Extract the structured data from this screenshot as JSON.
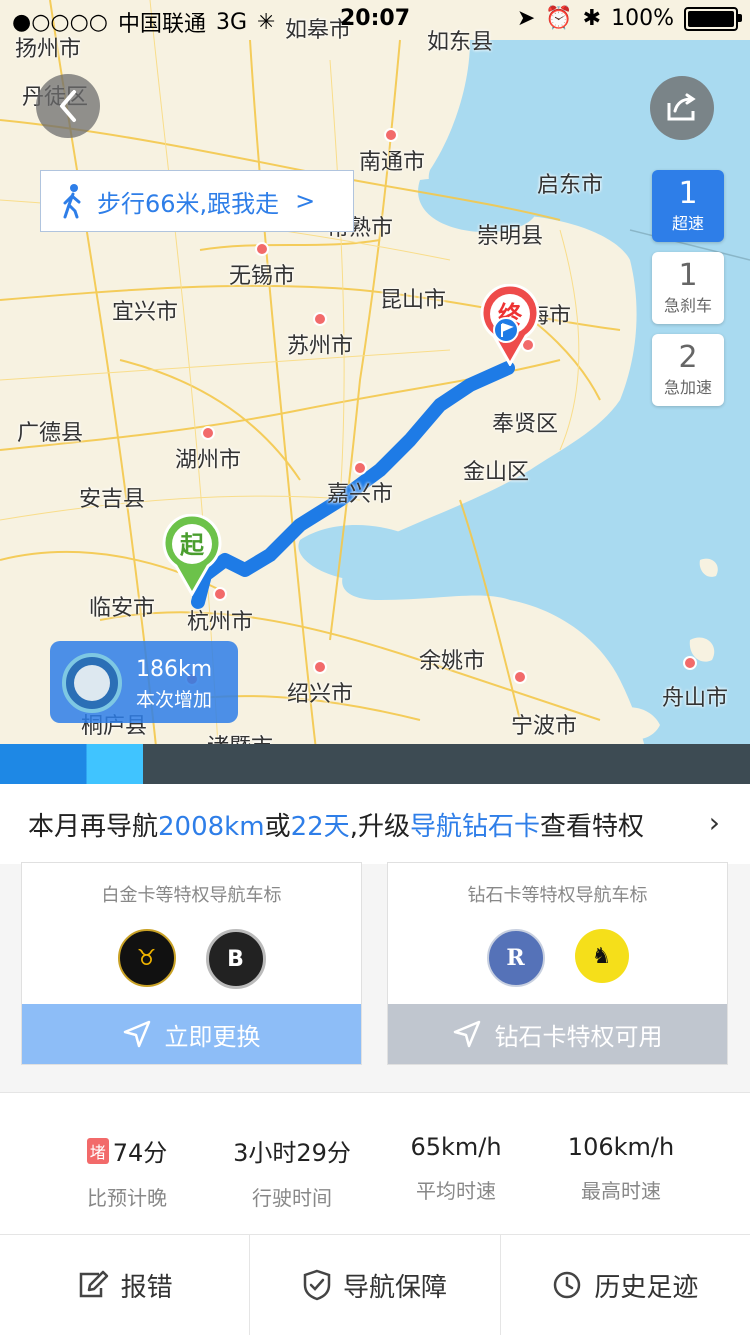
{
  "status_bar": {
    "signal": "●○○○○",
    "carrier": "中国联通",
    "network": "3G",
    "time": "20:07",
    "battery": "100%"
  },
  "map": {
    "cities": [
      {
        "name": "扬州市"
      },
      {
        "name": "如皋市"
      },
      {
        "name": "如东县"
      },
      {
        "name": "丹徒区"
      },
      {
        "name": "南通市"
      },
      {
        "name": "启东市"
      },
      {
        "name": "常熟市"
      },
      {
        "name": "崇明县"
      },
      {
        "name": "无锡市"
      },
      {
        "name": "宜兴市"
      },
      {
        "name": "昆山市"
      },
      {
        "name": "苏州市"
      },
      {
        "name": "上海市"
      },
      {
        "name": "广德县"
      },
      {
        "name": "奉贤区"
      },
      {
        "name": "湖州市"
      },
      {
        "name": "嘉兴市"
      },
      {
        "name": "金山区"
      },
      {
        "name": "安吉县"
      },
      {
        "name": "临安市"
      },
      {
        "name": "杭州市"
      },
      {
        "name": "余姚市"
      },
      {
        "name": "绍兴市"
      },
      {
        "name": "舟山市"
      },
      {
        "name": "桐庐县"
      },
      {
        "name": "宁波市"
      },
      {
        "name": "诸暨市"
      }
    ],
    "start_label": "起",
    "end_label": "终"
  },
  "walk_tip": {
    "text": "步行66米,跟我走",
    "arrow": ">"
  },
  "driving_stats": [
    {
      "count": "1",
      "label": "超速",
      "active": true
    },
    {
      "count": "1",
      "label": "急刹车",
      "active": false
    },
    {
      "count": "2",
      "label": "急加速",
      "active": false
    }
  ],
  "badge": {
    "distance": "186km",
    "label": "本次增加"
  },
  "progress": {
    "fraction": 0.19
  },
  "upgrade": {
    "prefix": "本月再导航",
    "distance": "2008km",
    "or": "或",
    "days": "22天",
    "middle": ",升级",
    "card_name": "导航钻石卡",
    "suffix": "查看特权"
  },
  "cards": [
    {
      "title": "白金卡等特权导航车标",
      "action": "立即更换",
      "color": "#8dbdf7"
    },
    {
      "title": "钻石卡等特权导航车标",
      "action": "钻石卡特权可用",
      "color": "#c0c6cf"
    }
  ],
  "trip_stats": [
    {
      "badge": "堵",
      "value": "74分",
      "label": "比预计晚"
    },
    {
      "value": "3小时29分",
      "label": "行驶时间"
    },
    {
      "value": "65km/h",
      "label": "平均时速"
    },
    {
      "value": "106km/h",
      "label": "最高时速"
    }
  ],
  "bottom_bar": [
    {
      "label": "报错",
      "icon": "edit-icon"
    },
    {
      "label": "导航保障",
      "icon": "shield-icon"
    },
    {
      "label": "历史足迹",
      "icon": "clock-icon"
    }
  ],
  "colors": {
    "accent": "#2e7ee8",
    "route": "#1e7be6",
    "water": "#a9daf0",
    "land": "#f7f2e1",
    "jam": "#f26a6a"
  }
}
